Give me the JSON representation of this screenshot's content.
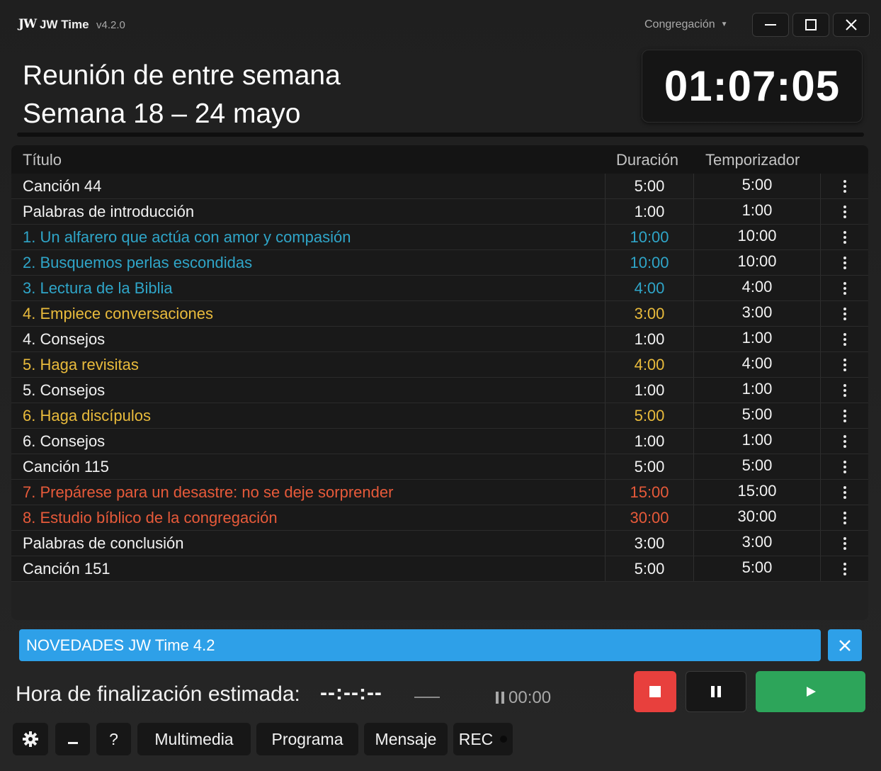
{
  "app": {
    "name": "JW Time",
    "version": "v4.2.0",
    "logo_text": "JW",
    "congregation_select": "Congregación"
  },
  "header": {
    "meeting_title": "Reunión de entre semana",
    "week": "Semana 18 – 24 mayo",
    "clock": "01:07:05"
  },
  "table": {
    "columns": {
      "title": "Título",
      "duration": "Duración",
      "timer": "Temporizador"
    },
    "rows": [
      {
        "title": "Canción 44",
        "duration": "5:00",
        "timer": "5:00",
        "color": "white"
      },
      {
        "title": "Palabras de introducción",
        "duration": "1:00",
        "timer": "1:00",
        "color": "white"
      },
      {
        "title": "1. Un alfarero que actúa con amor y compasión",
        "duration": "10:00",
        "timer": "10:00",
        "color": "blue"
      },
      {
        "title": "2. Busquemos perlas escondidas",
        "duration": "10:00",
        "timer": "10:00",
        "color": "blue"
      },
      {
        "title": "3. Lectura de la Biblia",
        "duration": "4:00",
        "timer": "4:00",
        "color": "blue"
      },
      {
        "title": "4. Empiece conversaciones",
        "duration": "3:00",
        "timer": "3:00",
        "color": "yellow"
      },
      {
        "title": "4. Consejos",
        "duration": "1:00",
        "timer": "1:00",
        "color": "white"
      },
      {
        "title": "5. Haga revisitas",
        "duration": "4:00",
        "timer": "4:00",
        "color": "yellow"
      },
      {
        "title": "5. Consejos",
        "duration": "1:00",
        "timer": "1:00",
        "color": "white"
      },
      {
        "title": "6. Haga discípulos",
        "duration": "5:00",
        "timer": "5:00",
        "color": "yellow"
      },
      {
        "title": "6. Consejos",
        "duration": "1:00",
        "timer": "1:00",
        "color": "white"
      },
      {
        "title": "Canción 115",
        "duration": "5:00",
        "timer": "5:00",
        "color": "white"
      },
      {
        "title": "7. Prepárese para un desastre: no se deje sorprender",
        "duration": "15:00",
        "timer": "15:00",
        "color": "red"
      },
      {
        "title": "8. Estudio bíblico de la congregación",
        "duration": "30:00",
        "timer": "30:00",
        "color": "red"
      },
      {
        "title": "Palabras de conclusión",
        "duration": "3:00",
        "timer": "3:00",
        "color": "white"
      },
      {
        "title": "Canción 151",
        "duration": "5:00",
        "timer": "5:00",
        "color": "white"
      }
    ]
  },
  "news": {
    "text": "NOVEDADES JW Time 4.2"
  },
  "footer": {
    "estimated_label": "Hora de finalización estimada:",
    "estimated_value": "--:--:--",
    "pause_time": "00:00",
    "buttons": {
      "help": "?",
      "media": "Multimedia",
      "program": "Programa",
      "message": "Mensaje",
      "rec": "REC"
    }
  },
  "colors": {
    "blue": "#2fa5c8",
    "yellow": "#e9bb3c",
    "red": "#e75a3a",
    "news_bg": "#2ea0e8",
    "stop": "#e8403d",
    "play": "#2da55a"
  }
}
